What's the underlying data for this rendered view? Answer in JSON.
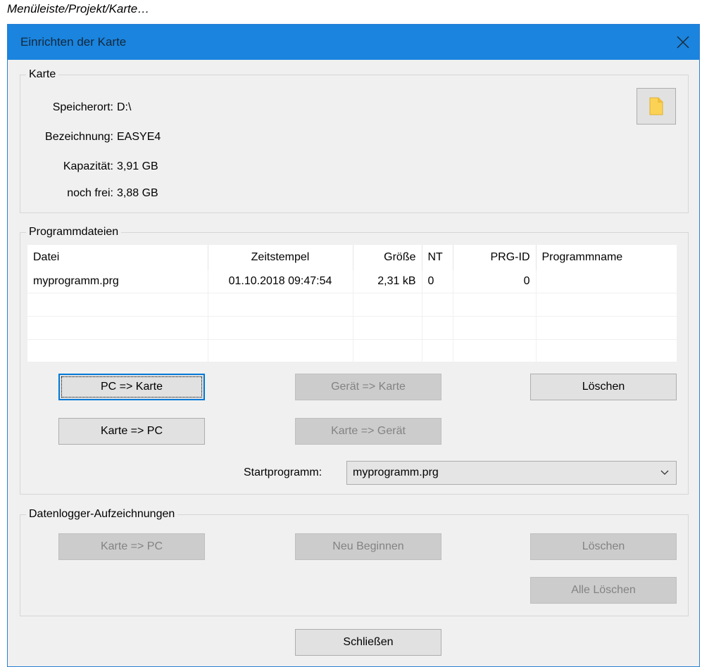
{
  "caption": "Menüleiste/Projekt/Karte…",
  "window": {
    "title": "Einrichten der Karte"
  },
  "karte": {
    "legend": "Karte",
    "rows": [
      {
        "label": "Speicherort:",
        "value": "D:\\"
      },
      {
        "label": "Bezeichnung:",
        "value": "EASYE4"
      },
      {
        "label": "Kapazität:",
        "value": "3,91 GB"
      },
      {
        "label": "noch frei:",
        "value": "3,88 GB"
      }
    ]
  },
  "programmdateien": {
    "legend": "Programmdateien",
    "columns": [
      "Datei",
      "Zeitstempel",
      "Größe",
      "NT",
      "PRG-ID",
      "Programmname"
    ],
    "rows": [
      {
        "datei": "myprogramm.prg",
        "zeitstempel": "01.10.2018 09:47:54",
        "groesse": "2,31 kB",
        "nt": "0",
        "prgid": "0",
        "programmname": ""
      }
    ],
    "buttons": {
      "pc_karte": "PC => Karte",
      "geraet_karte": "Gerät => Karte",
      "loeschen": "Löschen",
      "karte_pc": "Karte => PC",
      "karte_geraet": "Karte => Gerät"
    },
    "startprogramm_label": "Startprogramm:",
    "startprogramm_value": "myprogramm.prg"
  },
  "datenlogger": {
    "legend": "Datenlogger-Aufzeichnungen",
    "buttons": {
      "karte_pc": "Karte => PC",
      "neu_beginnen": "Neu Beginnen",
      "loeschen": "Löschen",
      "alle_loeschen": "Alle Löschen"
    }
  },
  "footer": {
    "schliessen": "Schließen"
  },
  "icons": {
    "close": "close-icon",
    "folder": "folder-icon",
    "dropdown": "chevron-down-icon"
  },
  "colors": {
    "titlebar": "#1a84de",
    "focus": "#0078d7",
    "folder": "#fcd256"
  }
}
